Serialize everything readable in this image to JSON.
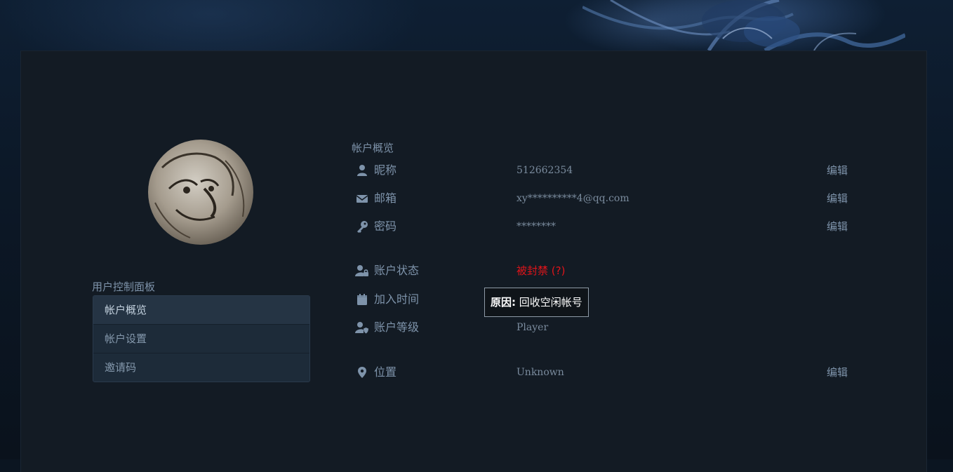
{
  "sidebar": {
    "title": "用户控制面板",
    "items": [
      {
        "label": "帐户概览",
        "active": true
      },
      {
        "label": "帐户设置",
        "active": false
      },
      {
        "label": "邀请码",
        "active": false
      }
    ]
  },
  "overview": {
    "title": "帐户概览",
    "rows": [
      {
        "icon": "user-icon",
        "label": "昵称",
        "value": "512662354",
        "edit": "编辑"
      },
      {
        "icon": "envelope-icon",
        "label": "邮箱",
        "value": "xy**********4@qq.com",
        "edit": "编辑"
      },
      {
        "icon": "key-icon",
        "label": "密码",
        "value": "********",
        "edit": "编辑"
      },
      {
        "icon": "user-lock-icon",
        "label": "账户状态",
        "value": "被封禁",
        "help": "(?)"
      },
      {
        "icon": "calendar-icon",
        "label": "加入时间",
        "value": ""
      },
      {
        "icon": "user-shield-icon",
        "label": "账户等级",
        "value": "Player"
      },
      {
        "icon": "map-pin-icon",
        "label": "位置",
        "value": "Unknown",
        "edit": "编辑"
      }
    ]
  },
  "tooltip": {
    "prefix": "原因:",
    "text": "回收空闲帐号"
  },
  "colors": {
    "panel_bg": "#131b24",
    "text_muted": "#7e93aa",
    "banned_red": "#e0141a",
    "menu_active": "#253444"
  }
}
